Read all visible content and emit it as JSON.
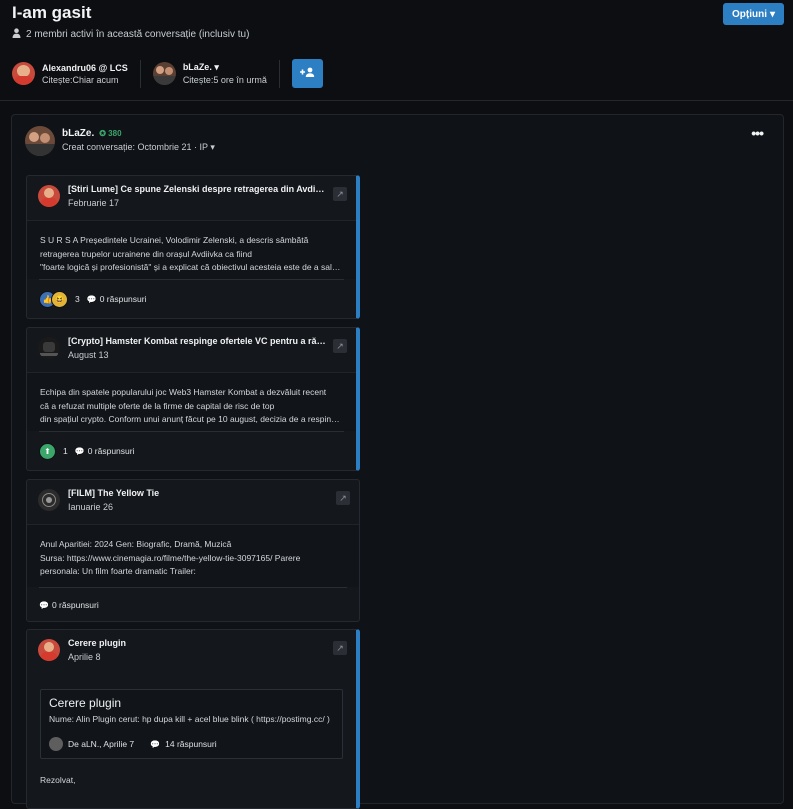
{
  "page": {
    "title": "I-am gasit",
    "members": "2 membri activi în această conversație (inclusiv tu)",
    "options_label": "Opțiuni"
  },
  "participants": [
    {
      "name": "Alexandru06 @ LCS",
      "read": "Citește:Chiar acum"
    },
    {
      "name": "bLaZe.",
      "read": "Citește:5 ore în urmă"
    }
  ],
  "post": {
    "author": "bLaZe.",
    "reputation": "380",
    "created": "Creat conversație: Octombrie 21 · IP"
  },
  "embeds": [
    {
      "title": "[Stiri Lume] Ce spune Zelenski despre retragerea din Avdiivka",
      "date": "Februarie 17",
      "lines": [
        "S U R S A Președintele Ucrainei, Volodimir Zelenski, a descris sâmbătă",
        "retragerea trupelor ucrainene din orașul Avdiivka ca fiind",
        "\"foarte logică și profesionistă\" și a explicat că obiectivul acesteia este de a salva viețile soldaților"
      ],
      "reaction_count": "3",
      "comments": "0 răspunsuri"
    },
    {
      "title": "[Crypto] Hamster Kombat respinge ofertele VC pentru a rămâne independent",
      "date": "August 13",
      "lines": [
        "Echipa din spatele popularului joc Web3 Hamster Kombat a dezvăluit recent",
        "că a refuzat multiple oferte de la firme de capital de risc de top",
        "din spațiul crypto. Conform unui anunț făcut pe 10 august, decizia de a respinge ofertele"
      ],
      "reaction_count": "1",
      "comments": "0 răspunsuri"
    },
    {
      "title": "[FILM] The Yellow Tie",
      "date": "Ianuarie 26",
      "lines": [
        "Anul Aparitiei: 2024 Gen: Biografic, Dramă, Muzică",
        "Sursa: https://www.cinemagia.ro/filme/the-yellow-tie-3097165/ Parere",
        "personala:  Un film foarte dramatic Trailer:"
      ],
      "comments": "0 răspunsuri"
    },
    {
      "title": "Cerere plugin",
      "date": "Aprilie 8",
      "quote": {
        "title": "Cerere plugin",
        "text": "Nume: Alin Plugin cerut:  hp dupa kill + acel blue blink ( https://postimg.cc/ )",
        "by": "De aLN., Aprilie 7",
        "comments": "14 răspunsuri"
      },
      "tail": "Rezolvat,"
    }
  ],
  "colors": {
    "accent": "#2d7fc4",
    "reputation": "#3aa66a",
    "background": "#0c0e11"
  }
}
